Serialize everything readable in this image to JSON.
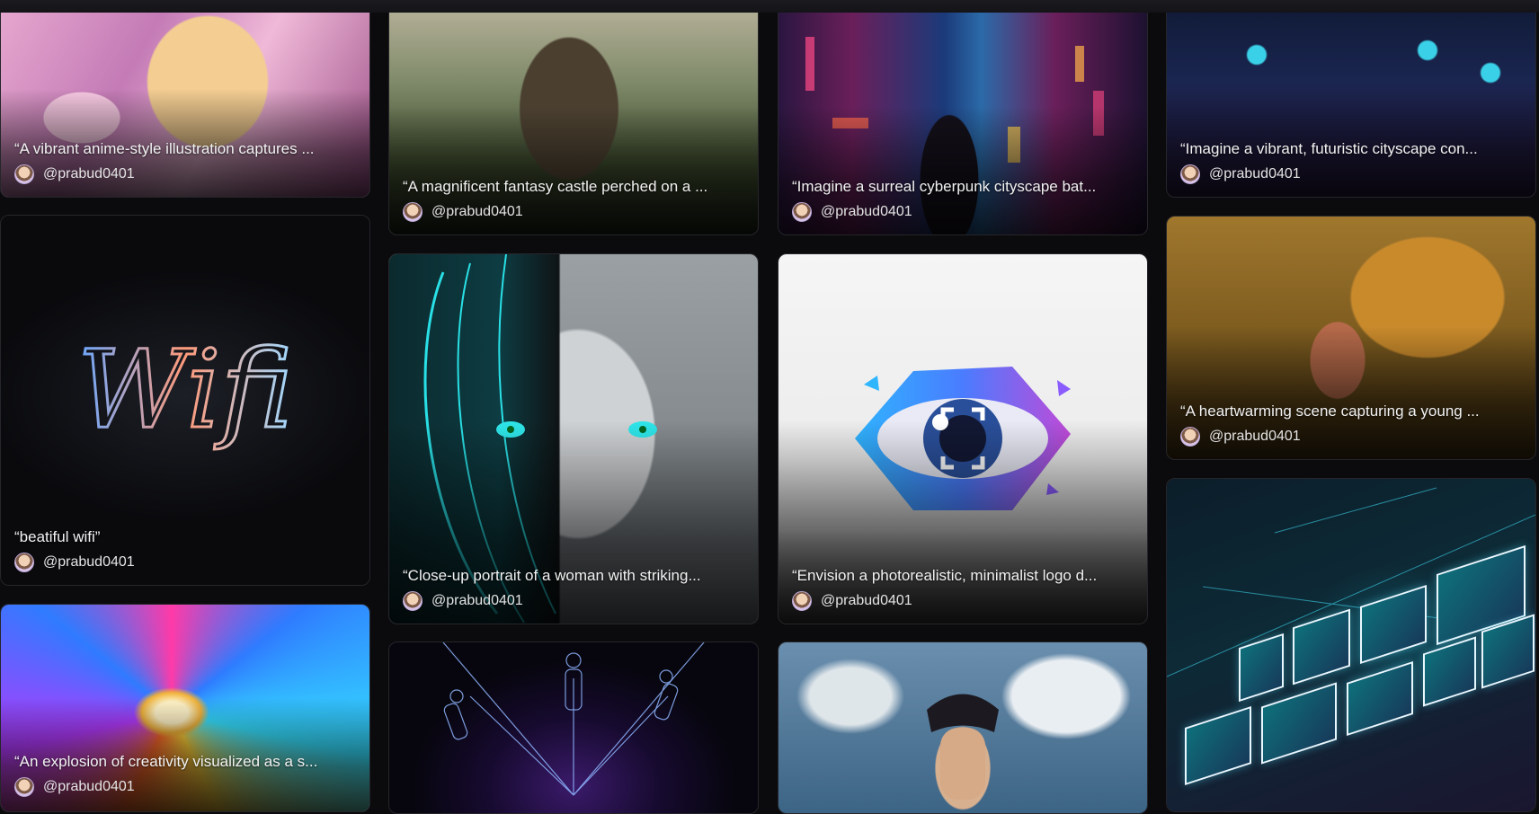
{
  "author": "@prabud0401",
  "cards": [
    {
      "prompt": "“A vibrant anime-style illustration captures ...",
      "author": "@prabud0401"
    },
    {
      "prompt": "“A magnificent fantasy castle perched on a ...",
      "author": "@prabud0401"
    },
    {
      "prompt": "“Imagine a surreal cyberpunk cityscape bat...",
      "author": "@prabud0401"
    },
    {
      "prompt": "“Imagine a vibrant, futuristic cityscape con...",
      "author": "@prabud0401"
    },
    {
      "prompt": "“beatiful wifi”",
      "author": "@prabud0401"
    },
    {
      "prompt": "“Close-up portrait of a woman with striking...",
      "author": "@prabud0401"
    },
    {
      "prompt": "“Envision a photorealistic, minimalist logo d...",
      "author": "@prabud0401"
    },
    {
      "prompt": "“A heartwarming scene capturing a young ...",
      "author": "@prabud0401"
    },
    {
      "prompt": "“An explosion of creativity visualized as a s...",
      "author": "@prabud0401"
    }
  ],
  "wifi_art_text": "Wifi"
}
